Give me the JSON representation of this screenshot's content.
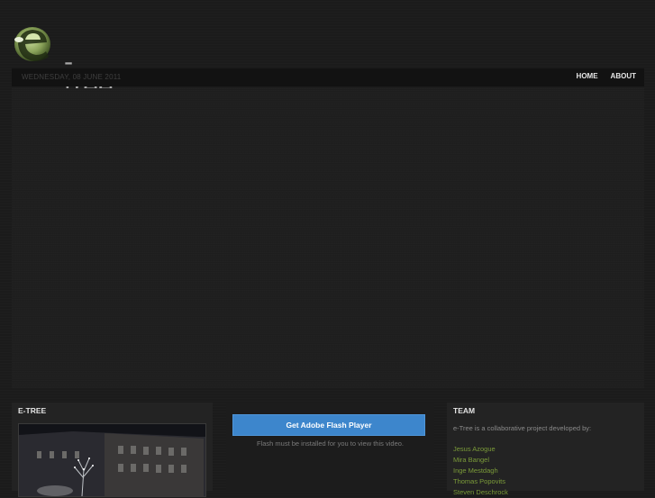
{
  "logo": {
    "text": "-tree",
    "icon": "e-leaf-logo-icon"
  },
  "navbar": {
    "date": "WEDNESDAY, 08 JUNE 2011",
    "links": [
      {
        "label": "HOME"
      },
      {
        "label": "ABOUT"
      }
    ]
  },
  "panels": {
    "etree": {
      "title": "E-TREE"
    },
    "flash": {
      "button_label": "Get Adobe Flash Player",
      "note": "Flash must be installed for you to view this video."
    },
    "team": {
      "title": "TEAM",
      "description": "e-Tree is a collaborative project developed by:",
      "members": [
        "Jesus Azogue",
        "Mira Bangel",
        "Inge Mestdagh",
        "Thomas Popovits",
        "Steven Deschrock"
      ]
    }
  },
  "colors": {
    "accent_green": "#7b9b39",
    "flash_blue": "#3d86cc"
  }
}
